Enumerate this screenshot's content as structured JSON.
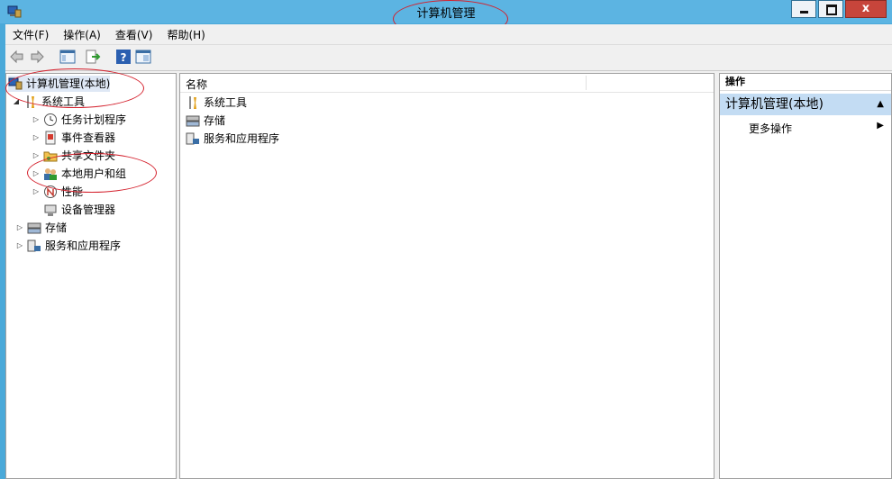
{
  "window": {
    "title": "计算机管理",
    "close_glyph": "x"
  },
  "menu": [
    "文件(F)",
    "操作(A)",
    "查看(V)",
    "帮助(H)"
  ],
  "toolbar_icons": [
    "back-arrow-icon",
    "forward-arrow-icon",
    "show-hide-tree-icon",
    "export-list-icon",
    "help-icon",
    "properties-icon"
  ],
  "tree": {
    "root": "计算机管理(本地)",
    "system_tools": "系统工具",
    "children": [
      "任务计划程序",
      "事件查看器",
      "共享文件夹",
      "本地用户和组",
      "性能",
      "设备管理器"
    ],
    "storage": "存储",
    "services": "服务和应用程序"
  },
  "list": {
    "column_name": "名称",
    "items": [
      "系统工具",
      "存储",
      "服务和应用程序"
    ]
  },
  "actions": {
    "header": "操作",
    "section": "计算机管理(本地)",
    "more": "更多操作"
  },
  "colors": {
    "titlebar": "#5cb4e2",
    "annotation": "#d4202c",
    "selection": "#c3dcf3"
  }
}
